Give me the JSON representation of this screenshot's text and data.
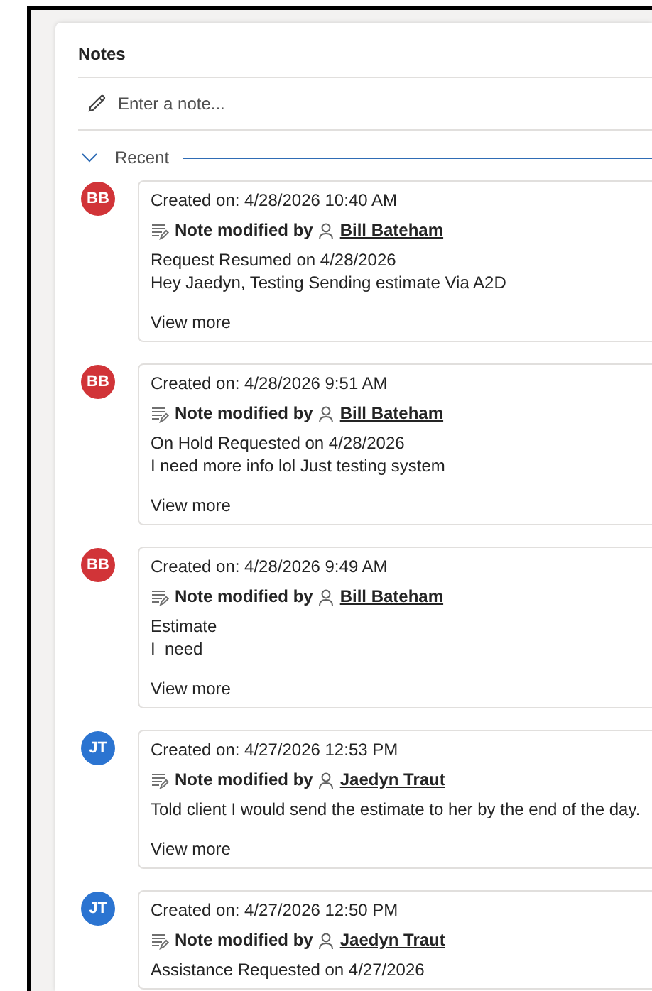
{
  "panel": {
    "title": "Notes",
    "note_input": {
      "placeholder": "Enter a note..."
    },
    "section": {
      "label": "Recent",
      "expanded": true
    }
  },
  "notes": [
    {
      "initials": "BB",
      "color": "#d13438",
      "created": "Created on: 4/28/2026 10:40 AM",
      "action": "Note modified by",
      "author": "Bill Bateham",
      "lines": [
        "Request Resumed on 4/28/2026",
        "Hey Jaedyn, Testing Sending estimate Via A2D"
      ],
      "link": "View more"
    },
    {
      "initials": "BB",
      "color": "#d13438",
      "created": "Created on: 4/28/2026 9:51 AM",
      "action": "Note modified by",
      "author": "Bill Bateham",
      "lines": [
        "On Hold Requested on 4/28/2026",
        "I need more info lol Just testing system"
      ],
      "link": "View more"
    },
    {
      "initials": "BB",
      "color": "#d13438",
      "created": "Created on: 4/28/2026 9:49 AM",
      "action": "Note modified by",
      "author": "Bill Bateham",
      "lines": [
        "Estimate",
        "I  need"
      ],
      "link": "View more"
    },
    {
      "initials": "JT",
      "color": "#2b74d1",
      "created": "Created on: 4/27/2026 12:53 PM",
      "action": "Note modified by",
      "author": "Jaedyn Traut",
      "lines": [
        "Told client I would send the estimate to her by the end of the day."
      ],
      "link": "View more"
    },
    {
      "initials": "JT",
      "color": "#2b74d1",
      "created": "Created on: 4/27/2026 12:50 PM",
      "action": "Note modified by",
      "author": "Jaedyn Traut",
      "lines": [
        "Assistance Requested on 4/27/2026"
      ]
    }
  ]
}
